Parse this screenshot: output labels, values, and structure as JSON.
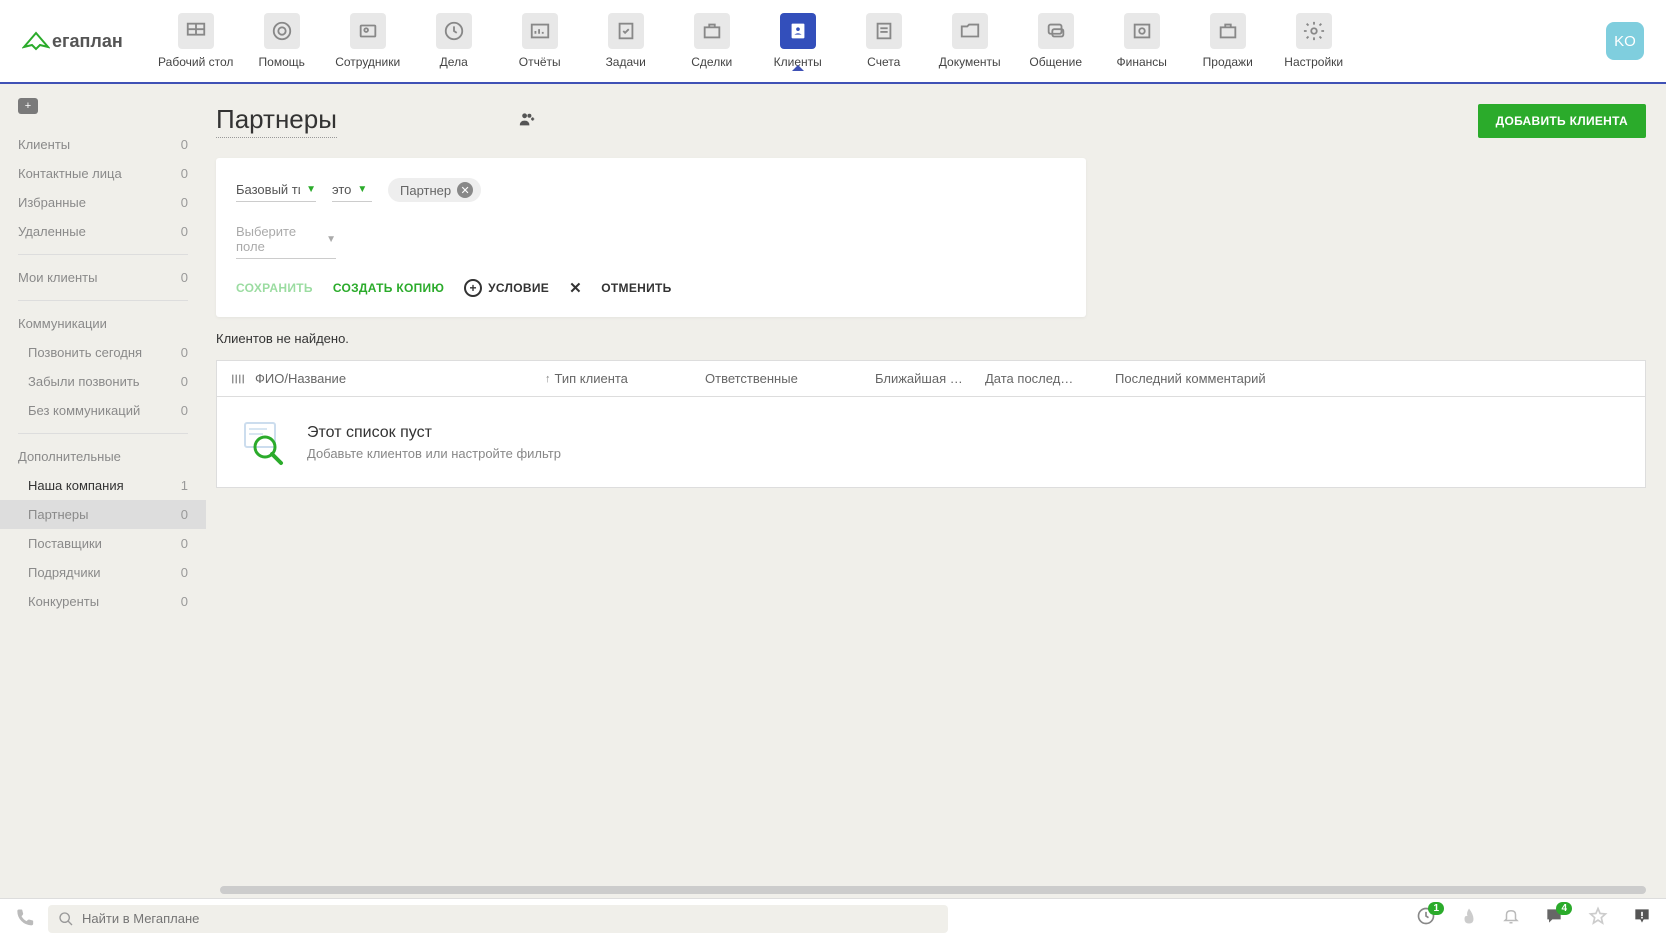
{
  "logo": "егаплан",
  "nav": [
    {
      "label": "Рабочий стол"
    },
    {
      "label": "Помощь"
    },
    {
      "label": "Сотрудники"
    },
    {
      "label": "Дела"
    },
    {
      "label": "Отчёты"
    },
    {
      "label": "Задачи"
    },
    {
      "label": "Сделки"
    },
    {
      "label": "Клиенты",
      "active": true
    },
    {
      "label": "Счета"
    },
    {
      "label": "Документы"
    },
    {
      "label": "Общение"
    },
    {
      "label": "Финансы"
    },
    {
      "label": "Продажи"
    },
    {
      "label": "Настройки"
    }
  ],
  "avatar": "KO",
  "sidebar": {
    "groups": [
      {
        "items": [
          {
            "label": "Клиенты",
            "count": "0"
          },
          {
            "label": "Контактные лица",
            "count": "0"
          },
          {
            "label": "Избранные",
            "count": "0"
          },
          {
            "label": "Удаленные",
            "count": "0"
          }
        ]
      },
      {
        "items": [
          {
            "label": "Мои клиенты",
            "count": "0"
          }
        ]
      },
      {
        "header": "Коммуникации",
        "items": [
          {
            "label": "Позвонить сегодня",
            "count": "0",
            "indent": true
          },
          {
            "label": "Забыли позвонить",
            "count": "0",
            "indent": true
          },
          {
            "label": "Без коммуникаций",
            "count": "0",
            "indent": true
          }
        ]
      },
      {
        "header": "Дополнительные",
        "items": [
          {
            "label": "Наша компания",
            "count": "1",
            "indent": true,
            "active": true
          },
          {
            "label": "Партнеры",
            "count": "0",
            "indent": true,
            "selected": true
          },
          {
            "label": "Поставщики",
            "count": "0",
            "indent": true
          },
          {
            "label": "Подрядчики",
            "count": "0",
            "indent": true
          },
          {
            "label": "Конкуренты",
            "count": "0",
            "indent": true
          }
        ]
      }
    ]
  },
  "page": {
    "title": "Партнеры",
    "add_client": "ДОБАВИТЬ КЛИЕНТА",
    "filter": {
      "field1": "Базовый тип",
      "op": "это",
      "tag": "Партнер",
      "choose": "Выберите поле",
      "save": "СОХРАНИТЬ",
      "copy": "СОЗДАТЬ КОПИЮ",
      "cond": "УСЛОВИЕ",
      "cancel": "ОТМЕНИТЬ"
    },
    "not_found": "Клиентов не найдено.",
    "columns": {
      "name": "ФИО/Название",
      "type": "Тип клиента",
      "resp": "Ответственные",
      "near": "Ближайшая …",
      "last": "Дата послед…",
      "comment": "Последний комментарий"
    },
    "empty": {
      "title": "Этот список пуст",
      "sub": "Добавьте клиентов или настройте фильтр"
    }
  },
  "search_placeholder": "Найти в Мегаплане",
  "bottom_badges": {
    "clock": "1",
    "chat": "4"
  }
}
